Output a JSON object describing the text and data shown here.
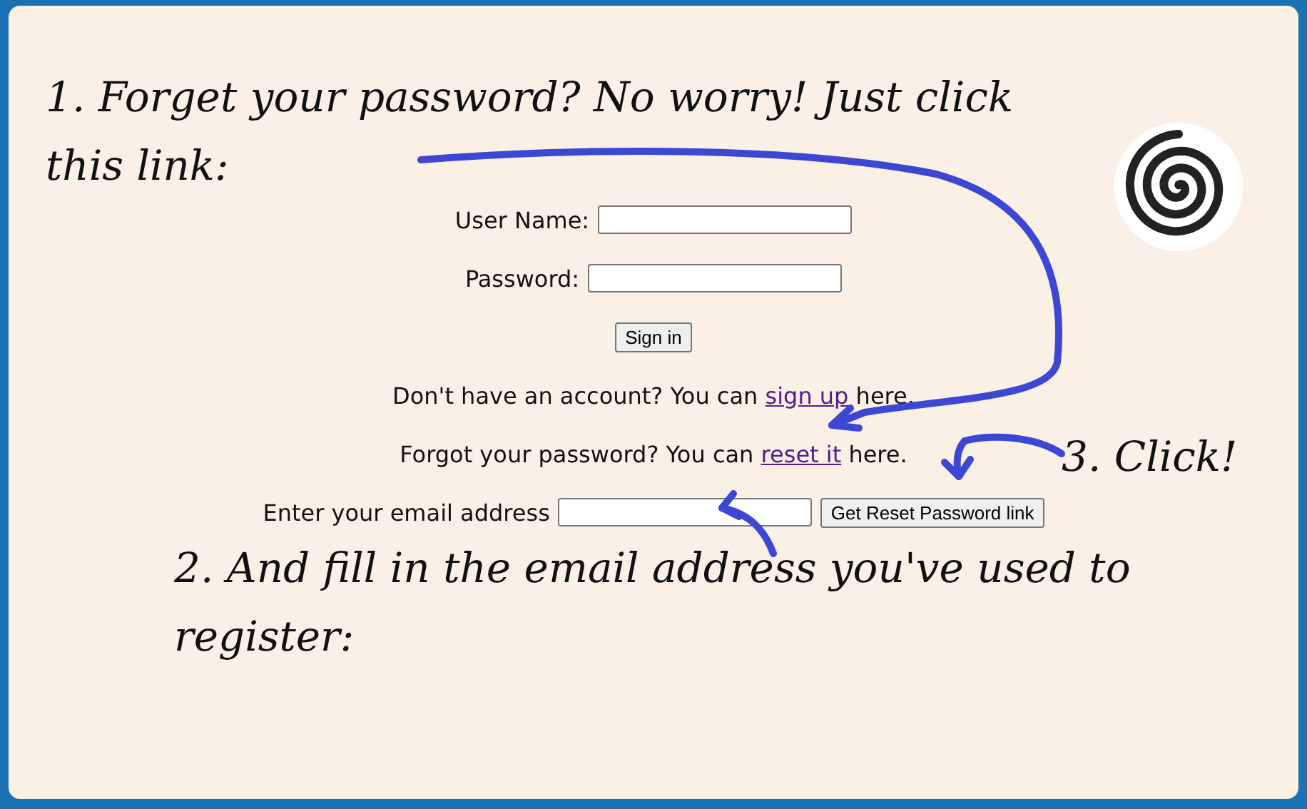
{
  "annotations": [
    {
      "text": "1. Forget your password? No worry! Just click this link:"
    },
    {
      "text": "2. And fill in the email address you've used to register:"
    },
    {
      "text": "3. Click!"
    }
  ],
  "form": {
    "fields": [
      {
        "label": "User Name:"
      },
      {
        "label": "Password:"
      }
    ],
    "submit": "Sign in",
    "signup": {
      "before": "Don't have an account? You can ",
      "link": "sign up",
      "after": " here."
    },
    "reset": {
      "before": "Forgot your password? You can ",
      "link": "reset it",
      "after": " here."
    },
    "email": {
      "label": "Enter your email address",
      "button": "Get Reset Password link"
    }
  }
}
